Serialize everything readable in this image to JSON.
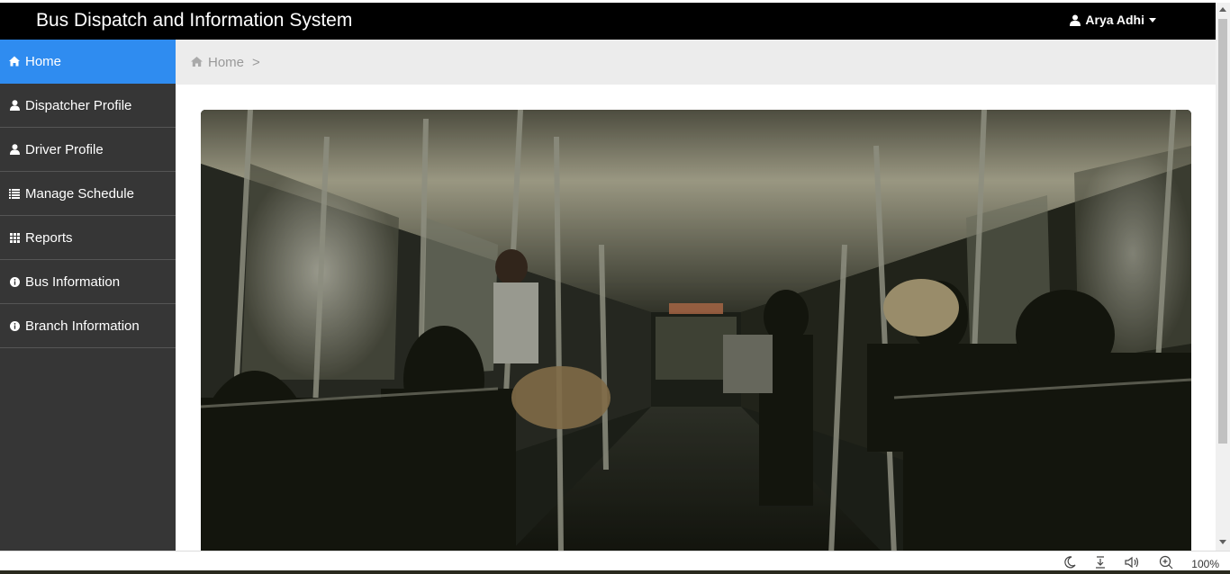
{
  "app": {
    "title": "Bus Dispatch and Information System",
    "user_name": "Arya Adhi"
  },
  "sidebar": {
    "items": [
      {
        "label": "Home",
        "icon": "home-icon",
        "active": true
      },
      {
        "label": "Dispatcher Profile",
        "icon": "user-icon",
        "active": false
      },
      {
        "label": "Driver Profile",
        "icon": "user-icon",
        "active": false
      },
      {
        "label": "Manage Schedule",
        "icon": "list-icon",
        "active": false
      },
      {
        "label": "Reports",
        "icon": "grid-icon",
        "active": false
      },
      {
        "label": "Bus Information",
        "icon": "info-icon",
        "active": false
      },
      {
        "label": "Branch Information",
        "icon": "info-icon",
        "active": false
      }
    ]
  },
  "breadcrumb": {
    "home": "Home",
    "separator": ">"
  },
  "browser_status": {
    "zoom": "100%"
  },
  "colors": {
    "navbar": "#000000",
    "sidebar": "#363636",
    "active": "#2f8cf0",
    "breadcrumb_bg": "#ececec"
  }
}
